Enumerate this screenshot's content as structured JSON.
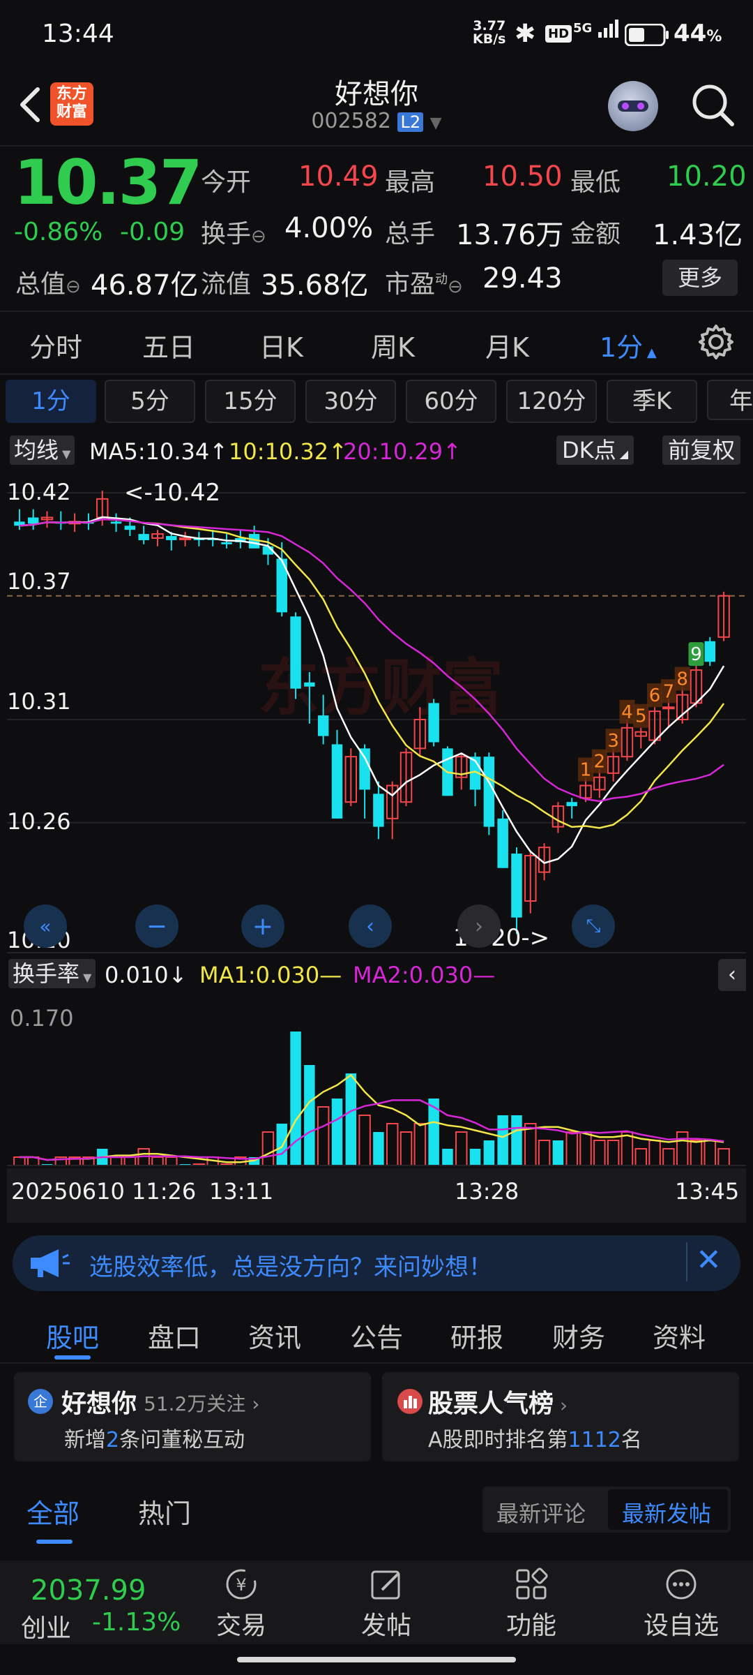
{
  "status_bar": {
    "time": "13:44",
    "net_speed_value": "3.77",
    "net_speed_unit": "KB/s",
    "hd": "HD",
    "signal": "5G",
    "battery": "44"
  },
  "header": {
    "logo_top": "东方",
    "logo_bottom": "财富",
    "title": "好想你",
    "code": "002582",
    "level_badge": "L2"
  },
  "quote": {
    "price": "10.37",
    "change_pct": "-0.86%",
    "change": "-0.09",
    "open_label": "今开",
    "open": "10.49",
    "high_label": "最高",
    "high": "10.50",
    "low_label": "最低",
    "low": "10.20",
    "turnover_label": "换手",
    "turnover": "4.00%",
    "volume_label": "总手",
    "volume": "13.76万",
    "amount_label": "金额",
    "amount": "1.43亿",
    "mcap_label": "总值",
    "mcap": "46.87亿",
    "float_label": "流值",
    "float_value": "35.68亿",
    "pe_label": "市盈",
    "pe_sup": "动",
    "pe": "29.43",
    "more": "更多"
  },
  "period_tabs": [
    "分时",
    "五日",
    "日K",
    "周K",
    "月K",
    "1分"
  ],
  "minute_buttons": [
    "1分",
    "5分",
    "15分",
    "30分",
    "60分",
    "120分",
    "季K",
    "年"
  ],
  "indicator_bar": {
    "selector": "均线",
    "ma5": "MA5:10.34↑",
    "ma10": "10:10.32↑",
    "ma20": "20:10.29↑",
    "dk": "DK点",
    "adjust": "前复权"
  },
  "watermark": "东方财富",
  "chart_data": {
    "type": "candlestick",
    "y_ticks": [
      "10.42",
      "10.37",
      "10.31",
      "10.26",
      "10.20"
    ],
    "ylim": [
      10.2,
      10.42
    ],
    "last_price_line": "10.37",
    "high_marker": "<-10.42",
    "low_marker": "10.20->",
    "td_counts": [
      "1",
      "2",
      "3",
      "4",
      "5",
      "6",
      "7",
      "8",
      "9"
    ],
    "colors": {
      "up": "#f5464b",
      "down": "#19e2ee",
      "ma5": "#ffffff",
      "ma10": "#f2e649",
      "ma20": "#d627d6"
    }
  },
  "sub_indicator": {
    "selector": "换手率",
    "value": "0.010↓",
    "ma1": "MA1:0.030",
    "ma2": "MA2:0.030",
    "y_tick": "0.170",
    "x_labels": [
      "20250610 11:26",
      "13:11",
      "13:28",
      "13:45"
    ]
  },
  "banner": {
    "text": "选股效率低，总是没方向？来问妙想！"
  },
  "content_tabs": [
    "股吧",
    "盘口",
    "资讯",
    "公告",
    "研报",
    "财务",
    "资料"
  ],
  "cards": {
    "left_badge": "企",
    "left_title": "好想你",
    "left_followers": "51.2万关注",
    "left_sub_pre": "新增",
    "left_sub_num": "2",
    "left_sub_post": "条问董秘互动",
    "right_title": "股票人气榜",
    "right_sub_pre": "A股即时排名第",
    "right_sub_num": "1112",
    "right_sub_post": "名"
  },
  "post_tabs": {
    "all": "全部",
    "hot": "热门",
    "latest_comment": "最新评论",
    "latest_post": "最新发帖"
  },
  "bottom_bar": {
    "index_value": "2037.99",
    "index_name": "创业",
    "index_change": "-1.13%",
    "items": [
      "交易",
      "发帖",
      "功能",
      "设自选"
    ]
  }
}
